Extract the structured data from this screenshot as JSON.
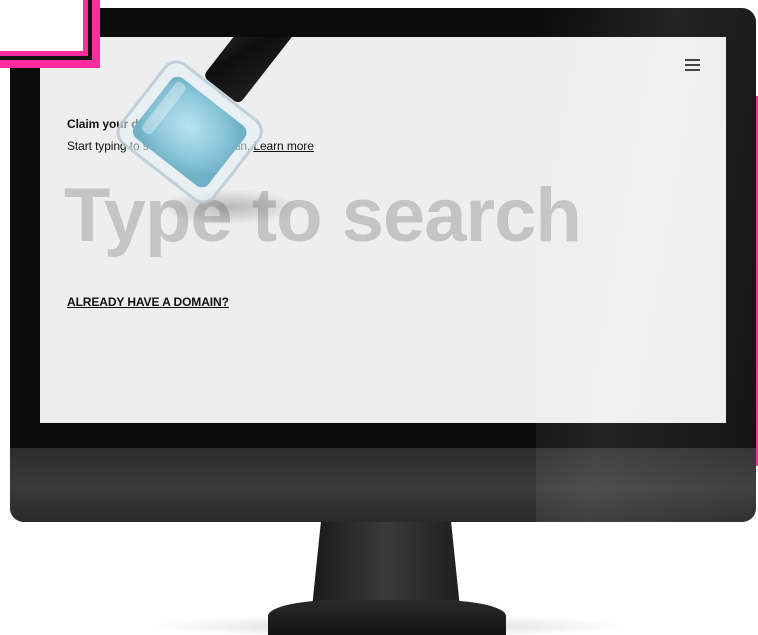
{
  "screen": {
    "heading": "Claim your domain.",
    "subtext": "Start typing to search for a domain.",
    "learn_more_label": "Learn more",
    "search": {
      "placeholder": "Type to search",
      "value": ""
    },
    "already_have_domain_label": "ALREADY HAVE A DOMAIN?",
    "menu_icon": "hamburger-menu-icon"
  },
  "colors": {
    "accent_pink": "#ff2d9b",
    "screen_bg": "#eeeeee",
    "placeholder_text": "#c4c4c4",
    "polish_blue": "#8fc9dc"
  }
}
